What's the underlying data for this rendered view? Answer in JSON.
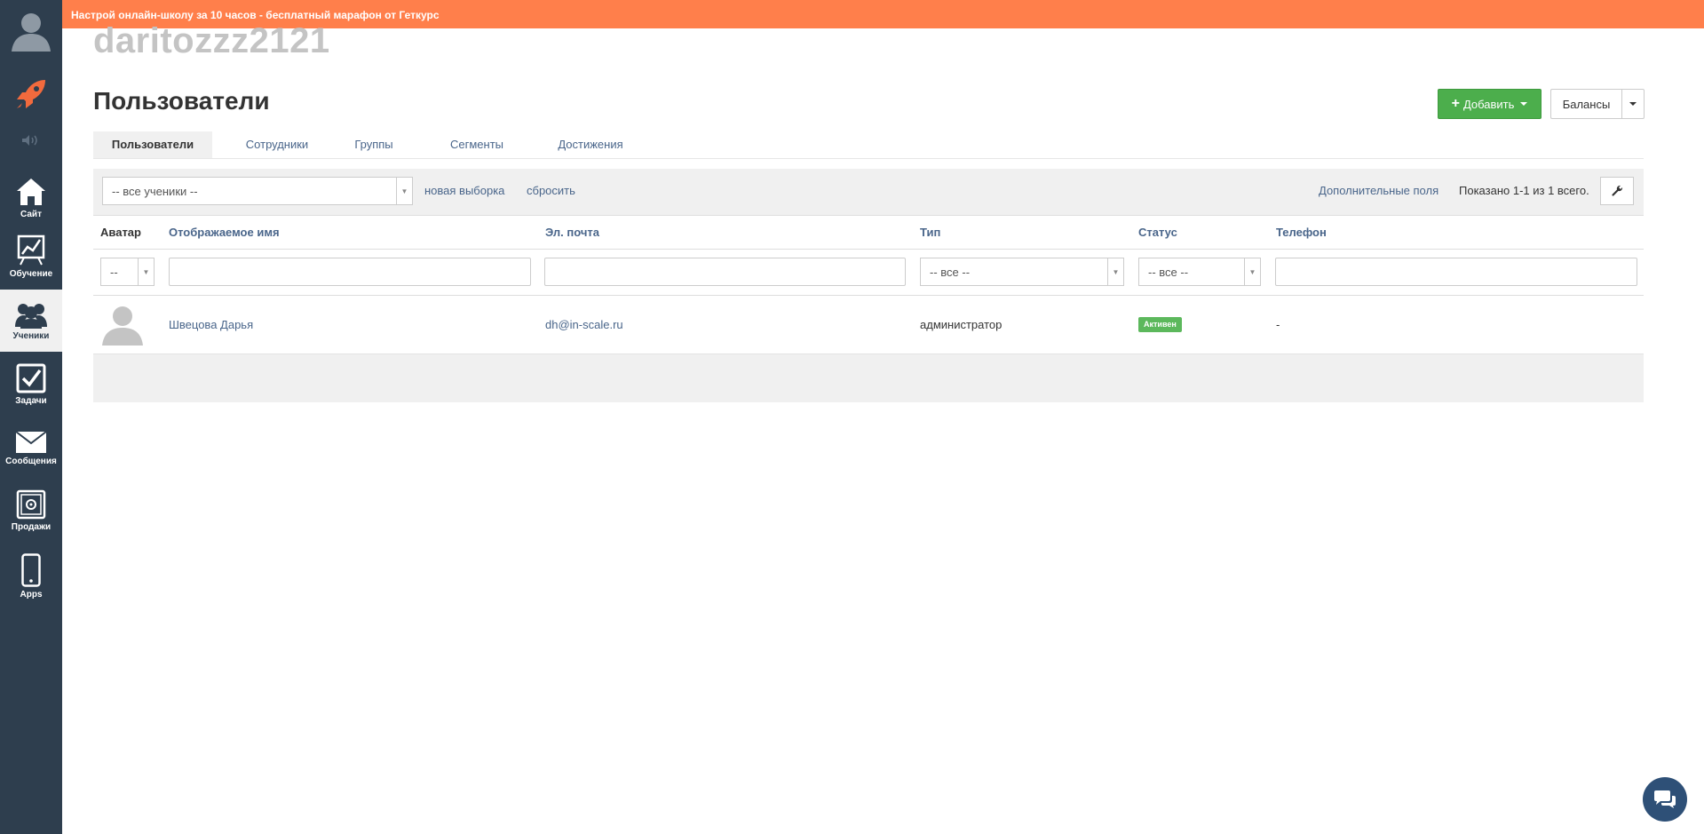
{
  "banner": {
    "text": "Настрой онлайн-школу за 10 часов - бесплатный марафон от Геткурс"
  },
  "school": {
    "name": "daritozzz2121"
  },
  "page": {
    "title": "Пользователи"
  },
  "actions": {
    "add_label": "Добавить",
    "balance_label": "Балансы"
  },
  "sidebar": {
    "items": [
      {
        "label": "Сайт",
        "icon": "home-icon"
      },
      {
        "label": "Обучение",
        "icon": "chart-icon"
      },
      {
        "label": "Ученики",
        "icon": "users-icon"
      },
      {
        "label": "Задачи",
        "icon": "checkbox-icon"
      },
      {
        "label": "Сообщения",
        "icon": "envelope-icon"
      },
      {
        "label": "Продажи",
        "icon": "safe-icon"
      },
      {
        "label": "Apps",
        "icon": "phone-icon"
      }
    ]
  },
  "tabs": [
    {
      "label": "Пользователи",
      "active": true
    },
    {
      "label": "Сотрудники"
    },
    {
      "label": "Группы"
    },
    {
      "label": "Сегменты"
    },
    {
      "label": "Достижения"
    }
  ],
  "filters": {
    "selection_value": "-- все ученики --",
    "new_selection": "новая выборка",
    "reset": "сбросить",
    "extra_fields": "Дополнительные поля",
    "shown": "Показано 1-1 из 1 всего."
  },
  "table": {
    "columns": [
      "Аватар",
      "Отображаемое имя",
      "Эл. почта",
      "Тип",
      "Статус",
      "Телефон"
    ],
    "filter_row": {
      "avatar": "--",
      "type": "-- все --",
      "status": "-- все --"
    },
    "rows": [
      {
        "name": "Швецова Дарья",
        "email": "dh@in-scale.ru",
        "type": "администратор",
        "status": "Активен",
        "phone": "-"
      }
    ]
  },
  "colors": {
    "banner": "#ff7f4b",
    "sidebar": "#2e3e4e",
    "add_button": "#4cae4c",
    "link": "#49658a",
    "status_active": "#5cb85c"
  }
}
